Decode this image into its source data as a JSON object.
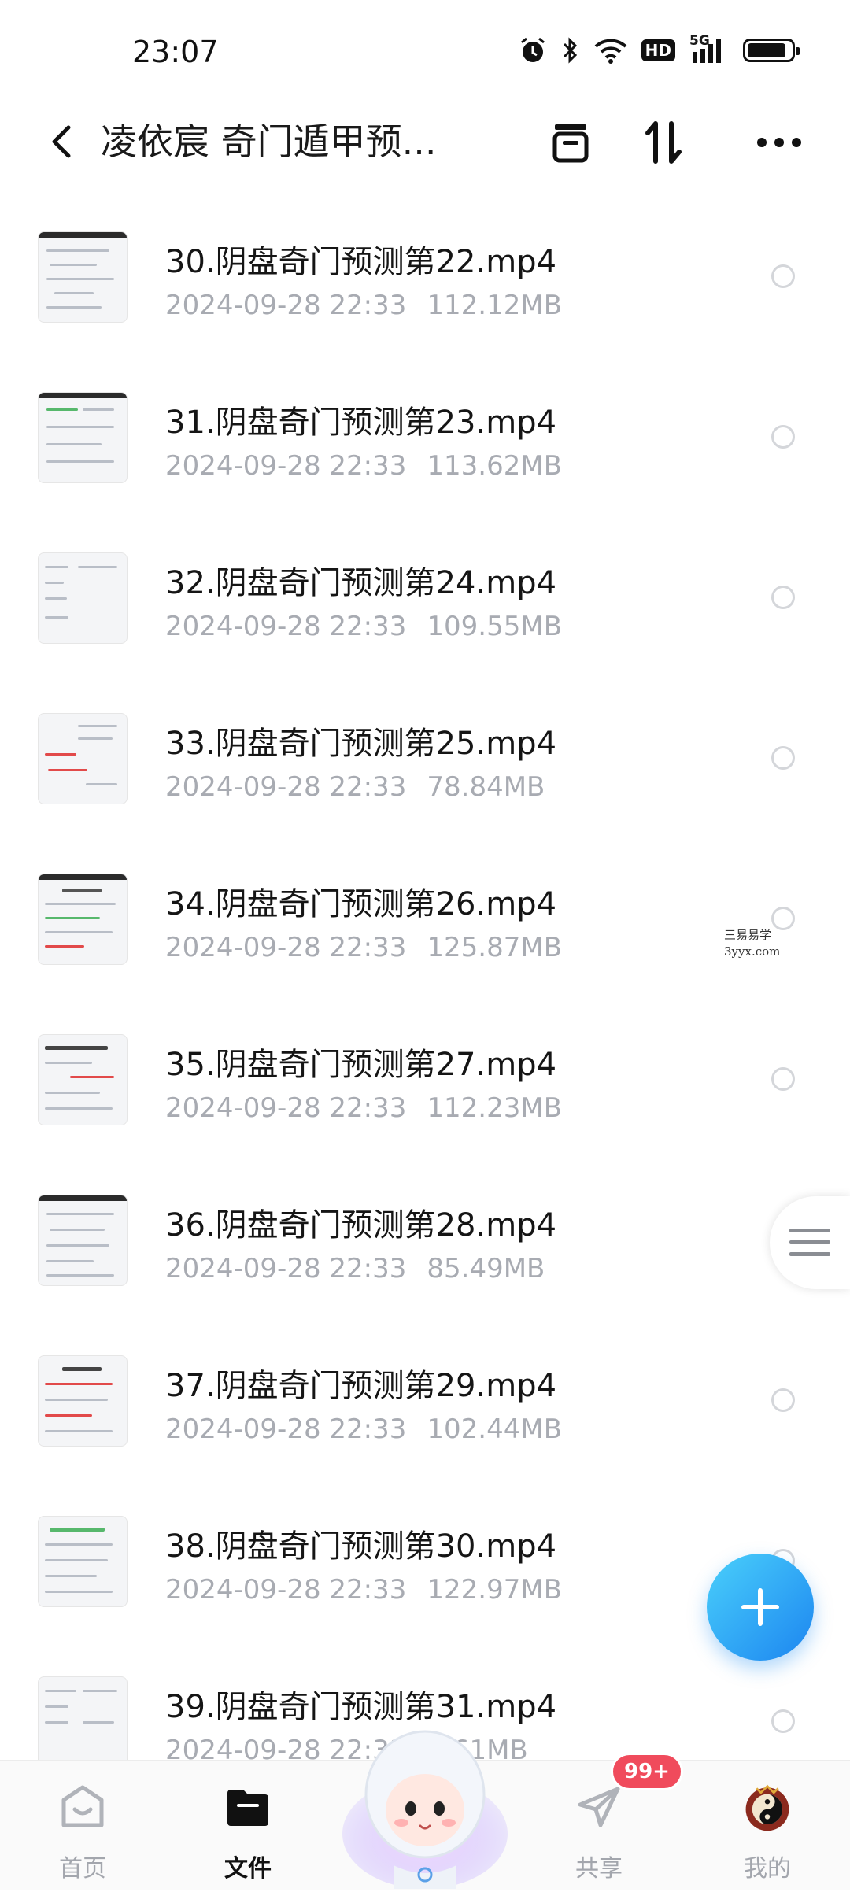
{
  "status": {
    "time": "23:07",
    "hd": "HD",
    "network": "5G"
  },
  "header": {
    "title": "凌依宸 奇门遁甲预..."
  },
  "files": [
    {
      "name": "30.阴盘奇门预测第22.mp4",
      "date": "2024-09-28",
      "time": "22:33",
      "size": "112.12MB"
    },
    {
      "name": "31.阴盘奇门预测第23.mp4",
      "date": "2024-09-28",
      "time": "22:33",
      "size": "113.62MB"
    },
    {
      "name": "32.阴盘奇门预测第24.mp4",
      "date": "2024-09-28",
      "time": "22:33",
      "size": "109.55MB"
    },
    {
      "name": "33.阴盘奇门预测第25.mp4",
      "date": "2024-09-28",
      "time": "22:33",
      "size": "78.84MB"
    },
    {
      "name": "34.阴盘奇门预测第26.mp4",
      "date": "2024-09-28",
      "time": "22:33",
      "size": "125.87MB"
    },
    {
      "name": "35.阴盘奇门预测第27.mp4",
      "date": "2024-09-28",
      "time": "22:33",
      "size": "112.23MB"
    },
    {
      "name": "36.阴盘奇门预测第28.mp4",
      "date": "2024-09-28",
      "time": "22:33",
      "size": "85.49MB"
    },
    {
      "name": "37.阴盘奇门预测第29.mp4",
      "date": "2024-09-28",
      "time": "22:33",
      "size": "102.44MB"
    },
    {
      "name": "38.阴盘奇门预测第30.mp4",
      "date": "2024-09-28",
      "time": "22:33",
      "size": "122.97MB"
    },
    {
      "name": "39.阴盘奇门预测第31.mp4",
      "date": "2024-09-28",
      "time": "22:33",
      "size": "...61MB"
    }
  ],
  "watermark": {
    "line1": "三易易学",
    "line2": "3yyx.com"
  },
  "nav": {
    "home": "首页",
    "files": "文件",
    "share": "共享",
    "share_badge": "99+",
    "mine": "我的"
  },
  "colors": {
    "accent": "#1c85f0",
    "badge": "#f04b5c",
    "meta": "#a8abb2"
  }
}
